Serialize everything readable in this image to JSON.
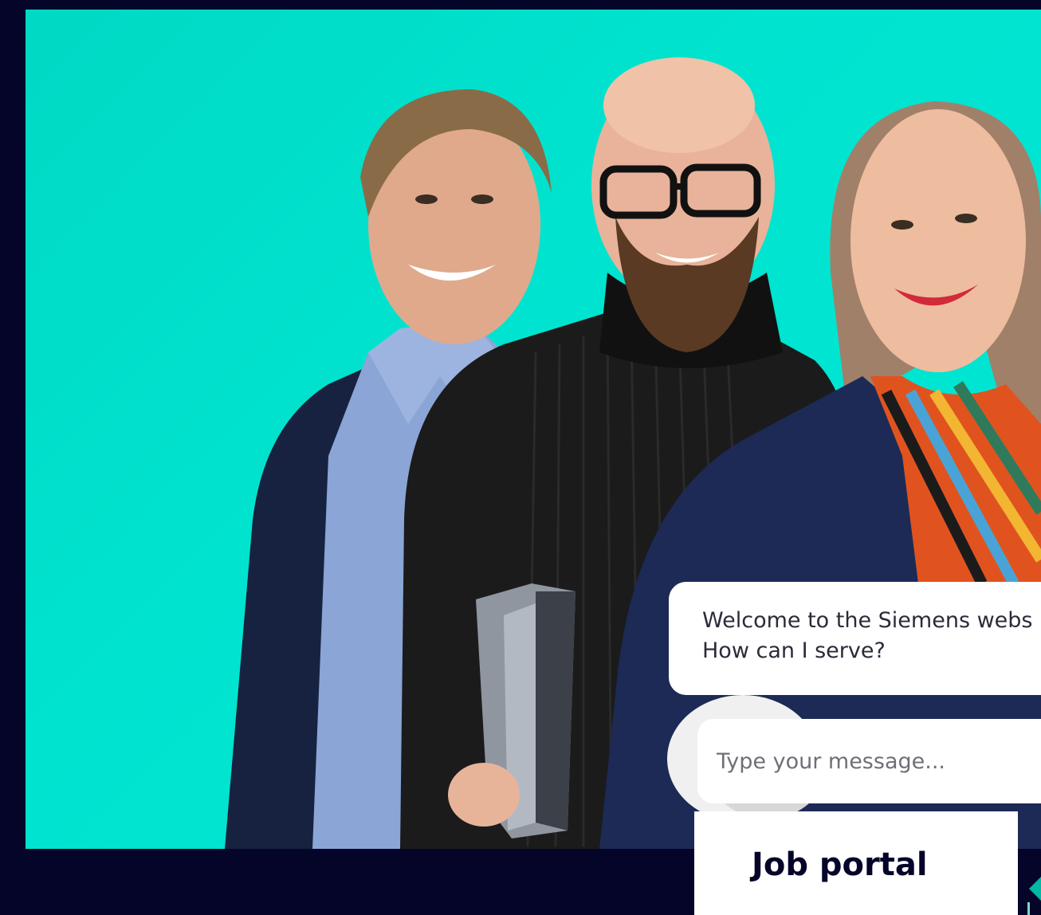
{
  "chat": {
    "welcome_line1": "Welcome to the Siemens webs",
    "welcome_line2": "How can I serve?",
    "input_placeholder": "Type your message..."
  },
  "cta": {
    "job_portal_label": "Job portal"
  },
  "colors": {
    "page_background": "#05052a",
    "hero_background": "#00e0cc",
    "bubble_background": "#ffffff",
    "cta_text": "#05052a"
  }
}
